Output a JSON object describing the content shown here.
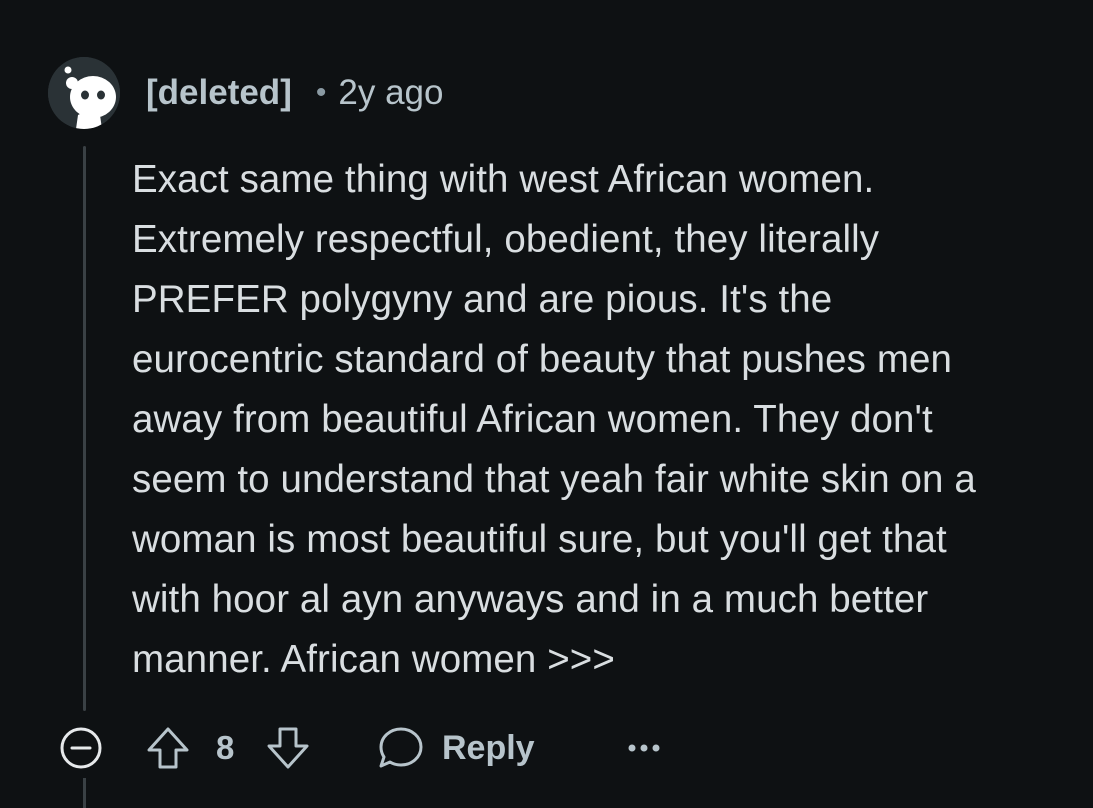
{
  "comment": {
    "author": "[deleted]",
    "separator": "•",
    "timestamp": "2y ago",
    "body_lines": [
      "Exact same thing with west African women.",
      "Extremely respectful, obedient, they literally",
      "PREFER polygyny and are pious. It's the",
      "eurocentric standard of beauty that pushes men",
      "away from beautiful African women. They don't",
      "seem to understand that yeah fair white skin on a",
      "woman is most beautiful sure, but you'll get that",
      "with hoor al ayn anyways and in a much better",
      "manner. African women >>>"
    ],
    "score": "8",
    "reply_label": "Reply"
  },
  "icons": {
    "avatar": "reddit-snoo-avatar-icon",
    "collapse": "collapse-minus-icon",
    "upvote": "upvote-arrow-icon",
    "downvote": "downvote-arrow-icon",
    "reply": "speech-bubble-icon",
    "more": "more-options-icon"
  },
  "colors": {
    "background": "#0e1113",
    "text": "#d9dee1",
    "meta_text": "#b7c4cb",
    "thread_line": "#3a4145"
  }
}
